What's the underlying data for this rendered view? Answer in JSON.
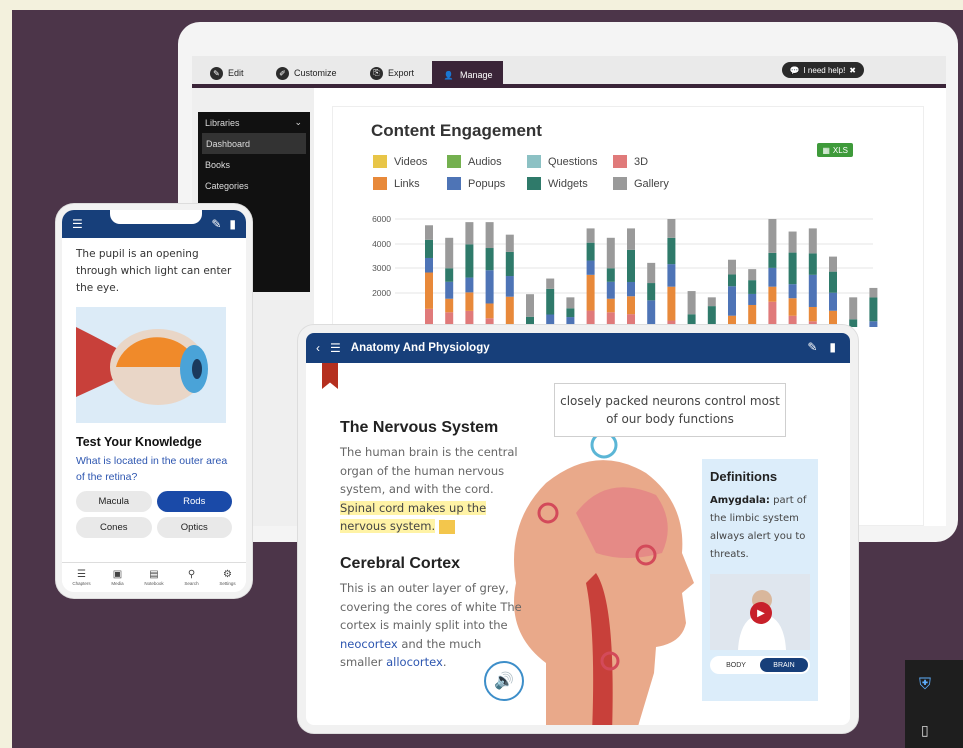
{
  "laptop": {
    "tabs": [
      {
        "label": "Edit",
        "icon": "pencil-icon"
      },
      {
        "label": "Customize",
        "icon": "brush-icon"
      },
      {
        "label": "Export",
        "icon": "export-icon"
      },
      {
        "label": "Manage",
        "icon": "user-icon"
      }
    ],
    "help_label": "I need help!",
    "sidebar": {
      "header": "Libraries",
      "items": [
        "Dashboard",
        "Books",
        "Categories"
      ]
    },
    "xls_label": "XLS"
  },
  "chart_data": {
    "type": "bar",
    "title": "Content Engagement",
    "stacked": true,
    "y_ticks": [
      "6000",
      "4000",
      "3000",
      "2000"
    ],
    "legend": [
      "Videos",
      "Audios",
      "Questions",
      "3D",
      "Links",
      "Popups",
      "Widgets",
      "Gallery"
    ],
    "colors": {
      "Videos": "#e8c547",
      "Audios": "#74b04f",
      "Questions": "#8cc1c4",
      "3D": "#e07a7a",
      "Links": "#e8893a",
      "Popups": "#4e74b6",
      "Widgets": "#2f7a6a",
      "Gallery": "#9a9a9a"
    },
    "bar_totals": [
      5800,
      5400,
      5900,
      5900,
      5500,
      3600,
      4100,
      3500,
      5700,
      5400,
      5700,
      4600,
      6000,
      3700,
      3500,
      4700,
      4400,
      6000,
      5600,
      5700,
      4800,
      3500,
      3800
    ]
  },
  "phone": {
    "intro": "The pupil is an opening through which light can enter the eye.",
    "quiz_title": "Test Your Knowledge",
    "question": "What is located in the outer area of the retina?",
    "options": [
      "Macula",
      "Rods",
      "Cones",
      "Optics"
    ],
    "nav": [
      "Chapters",
      "Media",
      "Notebook",
      "Search",
      "Settings"
    ]
  },
  "tablet": {
    "title": "Anatomy And Physiology",
    "callout": "closely packed neurons control most of our body functions",
    "h1": "The Nervous System",
    "p1a": "The human brain is the central organ of the human nervous system, and with the cord.",
    "p1_highlight": "Spinal cord makes up the nervous system.",
    "h2": "Cerebral Cortex",
    "p2a": "This is an outer layer of grey, covering the cores of white The cortex is mainly split into the",
    "link1": "neocortex",
    "p2b": "and the much smaller",
    "link2": "allocortex",
    "p2c": ".",
    "definitions": {
      "title": "Definitions",
      "term": "Amygdala:",
      "text": "part of the limbic system always alert you to threats.",
      "toggle": [
        "BODY",
        "BRAIN"
      ]
    }
  }
}
